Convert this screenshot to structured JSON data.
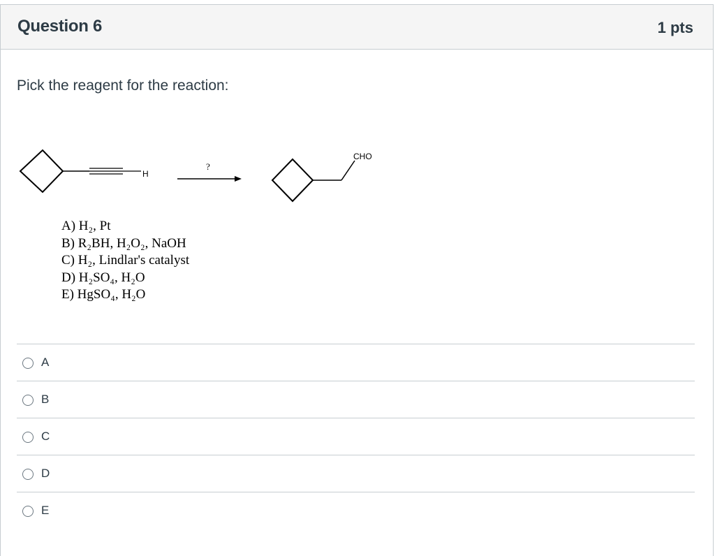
{
  "question": {
    "title": "Question 6",
    "points": "1 pts",
    "prompt": "Pick the reagent for the reaction:"
  },
  "reaction": {
    "terminal_label": "H",
    "arrow_label": "?",
    "product_label": "CHO",
    "options": [
      "A) H₂, Pt",
      "B) R₂BH, H₂O₂, NaOH",
      "C) H₂, Lindlar's catalyst",
      "D) H₂SO₄, H₂O",
      "E) HgSO₄, H₂O"
    ]
  },
  "answers": [
    {
      "label": "A"
    },
    {
      "label": "B"
    },
    {
      "label": "C"
    },
    {
      "label": "D"
    },
    {
      "label": "E"
    }
  ]
}
